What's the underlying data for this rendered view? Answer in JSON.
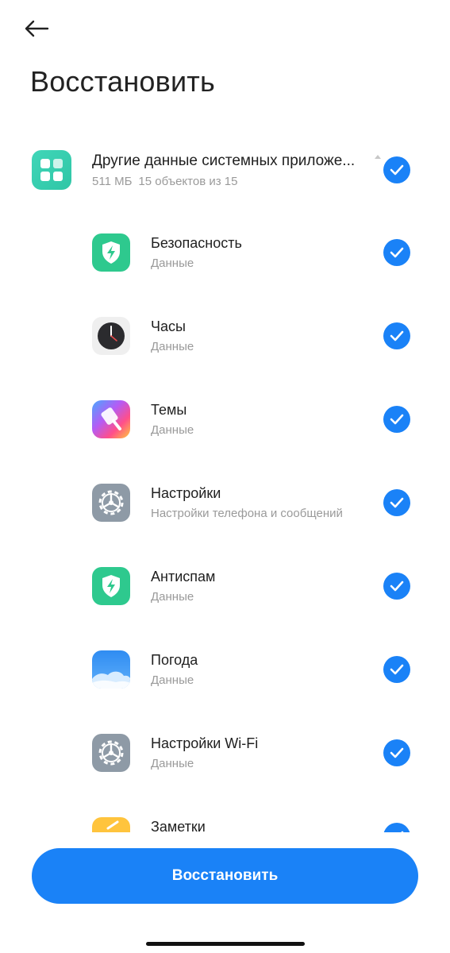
{
  "header": {
    "back_icon": "arrow-left-icon",
    "title": "Восстановить"
  },
  "group": {
    "icon": "apps-grid-icon",
    "title": "Другие данные системных приложе...",
    "size": "511 МБ",
    "count": "15 объектов из 15",
    "checked": true,
    "expand_icon": "caret-up-icon"
  },
  "apps": [
    {
      "name": "Безопасность",
      "sub": "Данные",
      "icon": "security-shield-icon",
      "checked": true
    },
    {
      "name": "Часы",
      "sub": "Данные",
      "icon": "clock-icon",
      "checked": true
    },
    {
      "name": "Темы",
      "sub": "Данные",
      "icon": "themes-brush-icon",
      "checked": true
    },
    {
      "name": "Настройки",
      "sub": "Настройки телефона и сообщений",
      "icon": "settings-gear-icon",
      "checked": true
    },
    {
      "name": "Антиспам",
      "sub": "Данные",
      "icon": "antispam-shield-icon",
      "checked": true
    },
    {
      "name": "Погода",
      "sub": "Данные",
      "icon": "weather-cloud-icon",
      "checked": true
    },
    {
      "name": "Настройки Wi-Fi",
      "sub": "Данные",
      "icon": "wifi-settings-gear-icon",
      "checked": true
    },
    {
      "name": "Заметки",
      "sub": "",
      "icon": "notes-icon",
      "checked": true
    }
  ],
  "footer": {
    "restore_label": "Восстановить"
  },
  "colors": {
    "accent": "#1a82f7",
    "group_icon": "#35cdb0",
    "security_green": "#2ec98e",
    "weather_blue": "#3d9cf5",
    "notes_yellow": "#ffc43d"
  }
}
